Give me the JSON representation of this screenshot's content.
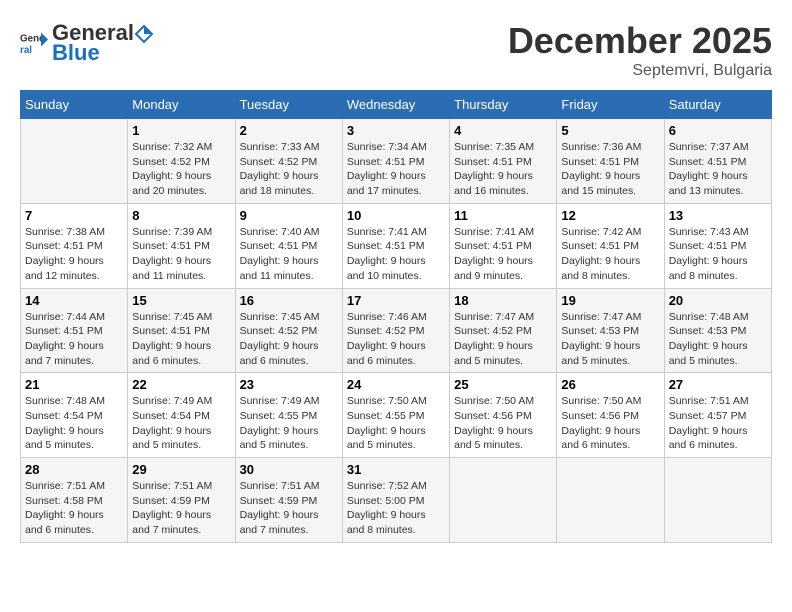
{
  "logo": {
    "general": "General",
    "blue": "Blue"
  },
  "title": "December 2025",
  "location": "Septemvri, Bulgaria",
  "days_header": [
    "Sunday",
    "Monday",
    "Tuesday",
    "Wednesday",
    "Thursday",
    "Friday",
    "Saturday"
  ],
  "weeks": [
    [
      {
        "day": "",
        "info": ""
      },
      {
        "day": "1",
        "info": "Sunrise: 7:32 AM\nSunset: 4:52 PM\nDaylight: 9 hours\nand 20 minutes."
      },
      {
        "day": "2",
        "info": "Sunrise: 7:33 AM\nSunset: 4:52 PM\nDaylight: 9 hours\nand 18 minutes."
      },
      {
        "day": "3",
        "info": "Sunrise: 7:34 AM\nSunset: 4:51 PM\nDaylight: 9 hours\nand 17 minutes."
      },
      {
        "day": "4",
        "info": "Sunrise: 7:35 AM\nSunset: 4:51 PM\nDaylight: 9 hours\nand 16 minutes."
      },
      {
        "day": "5",
        "info": "Sunrise: 7:36 AM\nSunset: 4:51 PM\nDaylight: 9 hours\nand 15 minutes."
      },
      {
        "day": "6",
        "info": "Sunrise: 7:37 AM\nSunset: 4:51 PM\nDaylight: 9 hours\nand 13 minutes."
      }
    ],
    [
      {
        "day": "7",
        "info": "Sunrise: 7:38 AM\nSunset: 4:51 PM\nDaylight: 9 hours\nand 12 minutes."
      },
      {
        "day": "8",
        "info": "Sunrise: 7:39 AM\nSunset: 4:51 PM\nDaylight: 9 hours\nand 11 minutes."
      },
      {
        "day": "9",
        "info": "Sunrise: 7:40 AM\nSunset: 4:51 PM\nDaylight: 9 hours\nand 11 minutes."
      },
      {
        "day": "10",
        "info": "Sunrise: 7:41 AM\nSunset: 4:51 PM\nDaylight: 9 hours\nand 10 minutes."
      },
      {
        "day": "11",
        "info": "Sunrise: 7:41 AM\nSunset: 4:51 PM\nDaylight: 9 hours\nand 9 minutes."
      },
      {
        "day": "12",
        "info": "Sunrise: 7:42 AM\nSunset: 4:51 PM\nDaylight: 9 hours\nand 8 minutes."
      },
      {
        "day": "13",
        "info": "Sunrise: 7:43 AM\nSunset: 4:51 PM\nDaylight: 9 hours\nand 8 minutes."
      }
    ],
    [
      {
        "day": "14",
        "info": "Sunrise: 7:44 AM\nSunset: 4:51 PM\nDaylight: 9 hours\nand 7 minutes."
      },
      {
        "day": "15",
        "info": "Sunrise: 7:45 AM\nSunset: 4:51 PM\nDaylight: 9 hours\nand 6 minutes."
      },
      {
        "day": "16",
        "info": "Sunrise: 7:45 AM\nSunset: 4:52 PM\nDaylight: 9 hours\nand 6 minutes."
      },
      {
        "day": "17",
        "info": "Sunrise: 7:46 AM\nSunset: 4:52 PM\nDaylight: 9 hours\nand 6 minutes."
      },
      {
        "day": "18",
        "info": "Sunrise: 7:47 AM\nSunset: 4:52 PM\nDaylight: 9 hours\nand 5 minutes."
      },
      {
        "day": "19",
        "info": "Sunrise: 7:47 AM\nSunset: 4:53 PM\nDaylight: 9 hours\nand 5 minutes."
      },
      {
        "day": "20",
        "info": "Sunrise: 7:48 AM\nSunset: 4:53 PM\nDaylight: 9 hours\nand 5 minutes."
      }
    ],
    [
      {
        "day": "21",
        "info": "Sunrise: 7:48 AM\nSunset: 4:54 PM\nDaylight: 9 hours\nand 5 minutes."
      },
      {
        "day": "22",
        "info": "Sunrise: 7:49 AM\nSunset: 4:54 PM\nDaylight: 9 hours\nand 5 minutes."
      },
      {
        "day": "23",
        "info": "Sunrise: 7:49 AM\nSunset: 4:55 PM\nDaylight: 9 hours\nand 5 minutes."
      },
      {
        "day": "24",
        "info": "Sunrise: 7:50 AM\nSunset: 4:55 PM\nDaylight: 9 hours\nand 5 minutes."
      },
      {
        "day": "25",
        "info": "Sunrise: 7:50 AM\nSunset: 4:56 PM\nDaylight: 9 hours\nand 5 minutes."
      },
      {
        "day": "26",
        "info": "Sunrise: 7:50 AM\nSunset: 4:56 PM\nDaylight: 9 hours\nand 6 minutes."
      },
      {
        "day": "27",
        "info": "Sunrise: 7:51 AM\nSunset: 4:57 PM\nDaylight: 9 hours\nand 6 minutes."
      }
    ],
    [
      {
        "day": "28",
        "info": "Sunrise: 7:51 AM\nSunset: 4:58 PM\nDaylight: 9 hours\nand 6 minutes."
      },
      {
        "day": "29",
        "info": "Sunrise: 7:51 AM\nSunset: 4:59 PM\nDaylight: 9 hours\nand 7 minutes."
      },
      {
        "day": "30",
        "info": "Sunrise: 7:51 AM\nSunset: 4:59 PM\nDaylight: 9 hours\nand 7 minutes."
      },
      {
        "day": "31",
        "info": "Sunrise: 7:52 AM\nSunset: 5:00 PM\nDaylight: 9 hours\nand 8 minutes."
      },
      {
        "day": "",
        "info": ""
      },
      {
        "day": "",
        "info": ""
      },
      {
        "day": "",
        "info": ""
      }
    ]
  ]
}
